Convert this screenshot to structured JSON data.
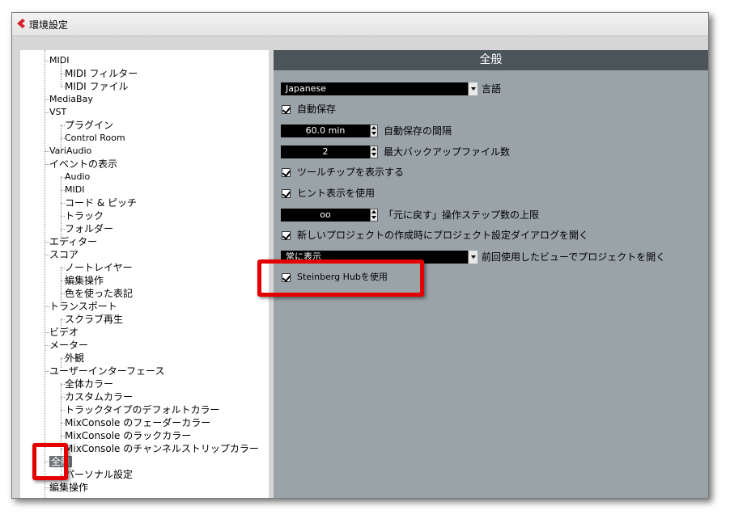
{
  "window": {
    "title": "環境設定"
  },
  "tree": {
    "items": [
      "MIDI",
      "MIDI フィルター",
      "MIDI ファイル",
      "MediaBay",
      "VST",
      "プラグイン",
      "Control Room",
      "VariAudio",
      "イベントの表示",
      "Audio",
      "MIDI",
      "コード & ピッチ",
      "トラック",
      "フォルダー",
      "エディター",
      "スコア",
      "ノートレイヤー",
      "編集操作",
      "色を使った表記",
      "トランスポート",
      "スクラブ再生",
      "ビデオ",
      "メーター",
      "外観",
      "ユーザーインターフェース",
      "全体カラー",
      "カスタムカラー",
      "トラックタイプのデフォルトカラー",
      "MixConsole のフェーダーカラー",
      "MixConsole のラックカラー",
      "MixConsole のチャンネルストリップカラー",
      "全般",
      "パーソナル設定",
      "編集操作"
    ],
    "selected": "全般"
  },
  "panel": {
    "title": "全般",
    "language": {
      "value": "Japanese",
      "label": "言語"
    },
    "autosave": {
      "label": "自動保存",
      "checked": true
    },
    "autosave_interval": {
      "value": "60.0 min",
      "label": "自動保存の間隔"
    },
    "max_backups": {
      "value": "2",
      "label": "最大バックアップファイル数"
    },
    "tooltips": {
      "label": "ツールチップを表示する",
      "checked": true
    },
    "hints": {
      "label": "ヒント表示を使用",
      "checked": true
    },
    "undo_steps": {
      "value": "oo",
      "label": "「元に戻す」操作ステップ数の上限"
    },
    "new_project_dialog": {
      "label": "新しいプロジェクトの作成時にプロジェクト設定ダイアログを開く",
      "checked": true
    },
    "open_view": {
      "value": "常に表示",
      "label": "前回使用したビューでプロジェクトを開く"
    },
    "steinberg_hub": {
      "label": "Steinberg Hubを使用",
      "checked": true
    }
  },
  "colors": {
    "highlight": "#e40000",
    "panel_bg": "#9aa3a8",
    "header_bg": "#4a5459",
    "app_icon": "#d8232a"
  }
}
